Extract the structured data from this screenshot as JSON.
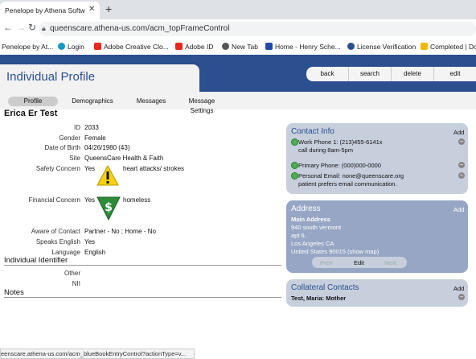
{
  "browser": {
    "tab_title": "Penelope by Athena Softwa",
    "tab_close": "✕",
    "new_tab": "+",
    "url": "queenscare.athena-us.com/acm_topFrameControl",
    "bookmarks": [
      {
        "label": "Penelope by At...",
        "icon": "penelope-icon",
        "color": "#999999"
      },
      {
        "label": "Login",
        "icon": "salesforce-icon",
        "color": "#1798c1"
      },
      {
        "label": "Adobe Creative Clo...",
        "icon": "adobe-icon",
        "color": "#e8261b"
      },
      {
        "label": "Adobe ID",
        "icon": "adobe-icon",
        "color": "#e8261b"
      },
      {
        "label": "New Tab",
        "icon": "globe-icon",
        "color": "#555555"
      },
      {
        "label": "Home - Henry Sche...",
        "icon": "henryschein-icon",
        "color": "#1f4aa8"
      },
      {
        "label": "License Verification",
        "icon": "license-icon",
        "color": "#2a4f8f"
      },
      {
        "label": "Completed | Do",
        "icon": "download-icon",
        "color": "#f2b705"
      }
    ],
    "status_url": "eenscare.athena-us.com/acm_blueBookEntryControl?actionType=v..."
  },
  "header": {
    "title": "Individual Profile",
    "actions": [
      "back",
      "search",
      "delete",
      "edit"
    ]
  },
  "tabs": [
    "Profile",
    "Demographics",
    "Messages",
    "Message Settings"
  ],
  "person": {
    "name": "Erica Er Test",
    "fields": [
      {
        "label": "ID",
        "value": "2033"
      },
      {
        "label": "Gender",
        "value": "Female"
      },
      {
        "label": "Date of Birth",
        "value": "04/26/1980 (43)"
      },
      {
        "label": "Site",
        "value": "QueensCare Health & Faith"
      }
    ],
    "safety_label": "Safety Concern",
    "safety_yes": "Yes",
    "safety_text": "heart attacks/ strokes",
    "financial_label": "Financial Concern",
    "financial_yes": "Yes",
    "financial_text": "homeless",
    "fields2": [
      {
        "label": "Aware of Contact",
        "value": "Partner - No ;  Home - No"
      },
      {
        "label": "Speaks English",
        "value": "Yes"
      },
      {
        "label": "Language",
        "value": "English"
      }
    ],
    "identifier_heading": "Individual Identifier",
    "identifiers": [
      {
        "label": "Other",
        "value": ""
      },
      {
        "label": "NII",
        "value": ""
      }
    ],
    "notes_heading": "Notes"
  },
  "contact_info": {
    "title": "Contact Info",
    "add": "Add",
    "items": [
      {
        "line1": "Work Phone 1: (213)455-6141x",
        "line2": "call during 8am-5pm"
      },
      {
        "line1": "Primary Phone: (000)000-0000",
        "line2": ""
      },
      {
        "line1": "Personal Email: none@queenscare.org",
        "line2": "patient prefers email communication."
      }
    ]
  },
  "address": {
    "title": "Address",
    "add": "Add",
    "heading": "Main Address",
    "lines": [
      "940 south vermont",
      "apt 6.",
      "Los Angeles CA",
      "United States 90015 (show map)"
    ],
    "buttons": [
      "Prev",
      "Edit",
      "Next"
    ]
  },
  "collateral": {
    "title": "Collateral Contacts",
    "add": "Add",
    "item": "Test, Maria: Mother"
  }
}
